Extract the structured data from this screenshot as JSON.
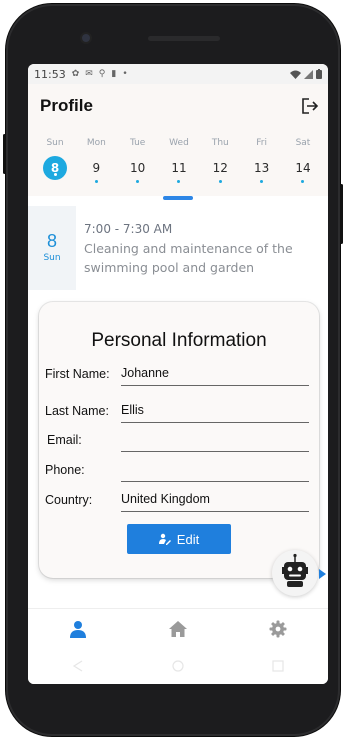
{
  "status_bar": {
    "time": "11:53",
    "left_icons": [
      "gear-icon",
      "mail-icon",
      "usb-icon",
      "sim-icon",
      "dot-icon"
    ],
    "right_icons": [
      "wifi-icon",
      "signal-icon",
      "battery-icon"
    ]
  },
  "header": {
    "title": "Profile",
    "logout_icon": "logout-icon"
  },
  "calendar": {
    "days": [
      {
        "name": "Sun",
        "num": "8",
        "selected": true
      },
      {
        "name": "Mon",
        "num": "9",
        "selected": false
      },
      {
        "name": "Tue",
        "num": "10",
        "selected": false
      },
      {
        "name": "Wed",
        "num": "11",
        "selected": false
      },
      {
        "name": "Thu",
        "num": "12",
        "selected": false
      },
      {
        "name": "Fri",
        "num": "13",
        "selected": false
      },
      {
        "name": "Sat",
        "num": "14",
        "selected": false
      }
    ]
  },
  "event": {
    "day": "8",
    "dow": "Sun",
    "time": "7:00 - 7:30 AM",
    "description": "Cleaning and maintenance of the swimming pool and garden"
  },
  "personal_info": {
    "title": "Personal Information",
    "fields": [
      {
        "label": "First Name:",
        "value": "Johanne"
      },
      {
        "label": "Last Name:",
        "value": "Ellis"
      },
      {
        "label": "Email:",
        "value": ""
      },
      {
        "label": "Phone:",
        "value": ""
      },
      {
        "label": "Country:",
        "value": "United Kingdom"
      }
    ],
    "edit_label": "Edit"
  },
  "bottom_nav": [
    {
      "icon": "person-icon",
      "active": true
    },
    {
      "icon": "home-icon",
      "active": false
    },
    {
      "icon": "settings-icon",
      "active": false
    }
  ],
  "colors": {
    "accent": "#1da9e0",
    "primary": "#1f7fdd",
    "nav_inactive": "#9a9a9a"
  }
}
